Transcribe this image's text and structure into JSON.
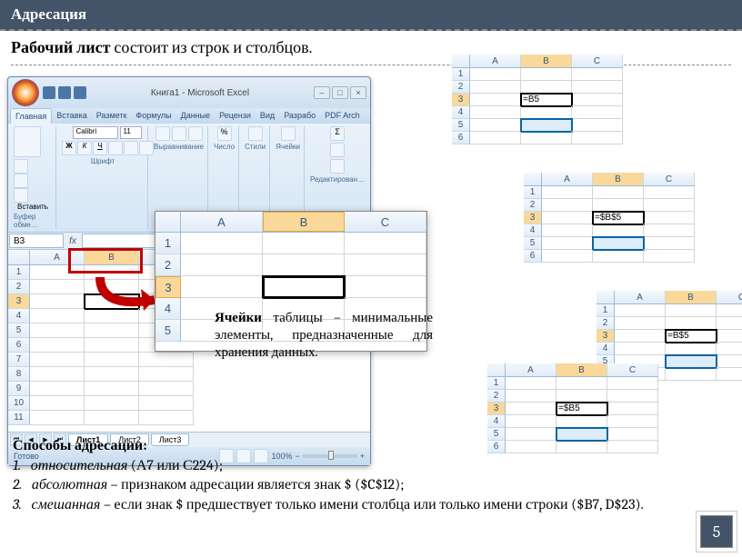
{
  "header": {
    "title": "Адресация"
  },
  "subtitle": {
    "bold": "Рабочий лист",
    "rest": " состоит из строк и столбцов."
  },
  "excel": {
    "window_title": "Книга1 - Microsoft Excel",
    "tabs": [
      "Главная",
      "Вставка",
      "Разметк",
      "Формулы",
      "Данные",
      "Рецензи",
      "Вид",
      "Разрабо",
      "PDF Arch"
    ],
    "active_tab": 0,
    "paste_label": "Вставить",
    "clipboard_group": "Буфер обме…",
    "font_name": "Calibri",
    "font_size": "11",
    "font_group": "Шрифт",
    "align_group": "Выравнивание",
    "number_group": "Число",
    "styles_group": "Стили",
    "cells_group": "Ячейки",
    "edit_group": "Редактирован…",
    "name_box": "B3",
    "columns": [
      "A",
      "B",
      "C"
    ],
    "rows": [
      1,
      2,
      3,
      4,
      5,
      6,
      7,
      8,
      9,
      10,
      11
    ],
    "active_cell": "B3",
    "sheets": [
      "Лист1",
      "Лист2",
      "Лист3"
    ],
    "active_sheet": 0,
    "status": "Готово",
    "zoom": "100%"
  },
  "zoom_panel": {
    "columns": [
      "A",
      "B",
      "C"
    ],
    "rows": [
      1,
      2,
      3,
      4,
      5
    ],
    "active_cell": "B3"
  },
  "cell_def": {
    "bold": "Ячейки",
    "rest": " таблицы – минимальные элементы, предназначенные для хранения данных."
  },
  "mini_grids": [
    {
      "formula": "=B5",
      "sel_cell": "B5"
    },
    {
      "formula": "=$B$5",
      "sel_cell": "B5"
    },
    {
      "formula": "=B$5",
      "sel_cell": "B5"
    },
    {
      "formula": "=$B5",
      "sel_cell": "B5"
    }
  ],
  "addressing": {
    "title": "Способы адресации:",
    "items": [
      {
        "num": "1.",
        "em": "относительная",
        "rest": " (А7  или С224);"
      },
      {
        "num": "2.",
        "em": "абсолютная",
        "rest": " – признаком адресации является знак $ ($C$12);"
      },
      {
        "num": "3.",
        "em": "смешанная",
        "rest": " – если знак $ предшествует только имени столбца или только имени строки ($B7, D$23)."
      }
    ]
  },
  "page_number": "5"
}
